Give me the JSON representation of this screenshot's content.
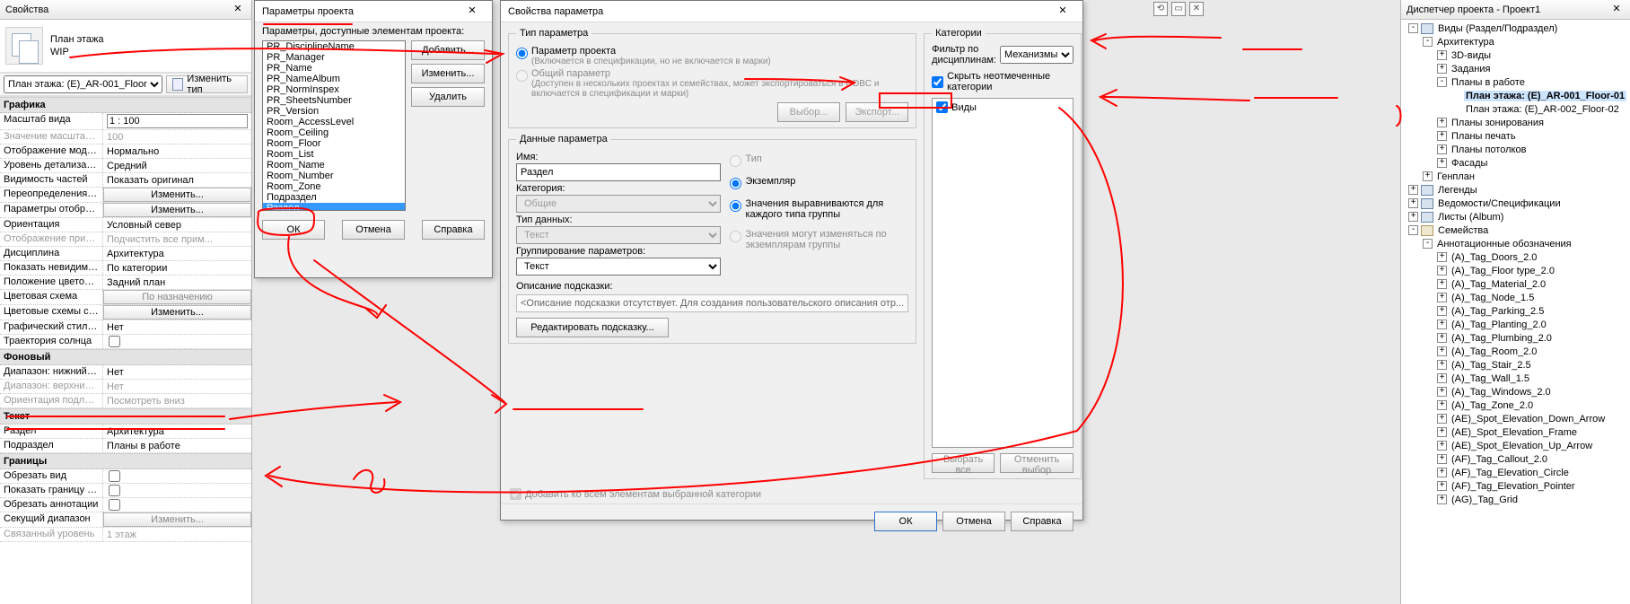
{
  "properties": {
    "title": "Свойства",
    "head_line1": "План этажа",
    "head_line2": "WIP",
    "selector": "План этажа: (E)_AR-001_Floor",
    "edit_type": "Изменить тип",
    "groups": [
      {
        "name": "Графика",
        "rows": [
          {
            "k": "Масштаб вида",
            "v": "1 : 100",
            "input": true
          },
          {
            "k": "Значение масштаба...",
            "v": "100",
            "dim": true
          },
          {
            "k": "Отображение модели",
            "v": "Нормально"
          },
          {
            "k": "Уровень детализации",
            "v": "Средний"
          },
          {
            "k": "Видимость частей",
            "v": "Показать оригинал"
          },
          {
            "k": "Переопределения в...",
            "v": "Изменить...",
            "btn": true
          },
          {
            "k": "Параметры отобра...",
            "v": "Изменить...",
            "btn": true
          },
          {
            "k": "Ориентация",
            "v": "Условный север"
          },
          {
            "k": "Отображение прим...",
            "v": "Подчистить все прим...",
            "dim": true
          },
          {
            "k": "Дисциплина",
            "v": "Архитектура"
          },
          {
            "k": "Показать невидимы...",
            "v": "По категории"
          },
          {
            "k": "Положение цветово...",
            "v": "Задний план"
          },
          {
            "k": "Цветовая схема",
            "v": "По назначению",
            "btn": true,
            "dimbtn": true
          },
          {
            "k": "Цветовые схемы сис...",
            "v": "Изменить...",
            "btn": true
          },
          {
            "k": "Графический стиль ...",
            "v": "Нет"
          },
          {
            "k": "Траектория солнца",
            "v": "",
            "chk": true
          }
        ]
      },
      {
        "name": "Фоновый",
        "rows": [
          {
            "k": "Диапазон: нижний у...",
            "v": "Нет"
          },
          {
            "k": "Диапазон: верхний у...",
            "v": "Нет",
            "dim": true
          },
          {
            "k": "Ориентация подлож...",
            "v": "Посмотреть вниз",
            "dim": true
          }
        ]
      },
      {
        "name": "Текст",
        "rows": [
          {
            "k": "Раздел",
            "v": "Архитектура"
          },
          {
            "k": "Подраздел",
            "v": "Планы в работе"
          }
        ]
      },
      {
        "name": "Границы",
        "rows": [
          {
            "k": "Обрезать вид",
            "v": "",
            "chk": true
          },
          {
            "k": "Показать границу о...",
            "v": "",
            "chk": true
          },
          {
            "k": "Обрезать аннотации",
            "v": "",
            "chk": true
          },
          {
            "k": "Секущий диапазон",
            "v": "Изменить...",
            "btn": true,
            "dimbtn": true
          },
          {
            "k": "Связанный уровень",
            "v": "1 этаж",
            "dim": true
          }
        ]
      }
    ]
  },
  "dlg1": {
    "title": "Параметры проекта",
    "label": "Параметры, доступные элементам проекта:",
    "items": [
      "PR_DisciplineName",
      "PR_Manager",
      "PR_Name",
      "PR_NameAlbum",
      "PR_NormInspex",
      "PR_SheetsNumber",
      "PR_Version",
      "Room_AccessLevel",
      "Room_Ceiling",
      "Room_Floor",
      "Room_List",
      "Room_Name",
      "Room_Number",
      "Room_Zone",
      "Подраздел",
      "Раздел"
    ],
    "selected": "Раздел",
    "btn_add": "Добавить...",
    "btn_edit": "Изменить...",
    "btn_del": "Удалить",
    "ok": "ОК",
    "cancel": "Отмена",
    "help": "Справка"
  },
  "dlg2": {
    "title": "Свойства параметра",
    "grp_type": "Тип параметра",
    "opt_proj": "Параметр проекта",
    "opt_proj_sub": "(Включается в спецификации, но не включается в марки)",
    "opt_shared": "Общий параметр",
    "opt_shared_sub": "(Доступен в нескольких проектах и семействах, может экспортироваться в ODBC и включается в спецификации и марки)",
    "btn_select": "Выбор...",
    "btn_export": "Экспорт...",
    "grp_data": "Данные параметра",
    "name_lbl": "Имя:",
    "name_val": "Раздел",
    "cat_lbl": "Категория:",
    "cat_val": "Общие",
    "dtype_lbl": "Тип данных:",
    "dtype_val": "Текст",
    "groupby_lbl": "Группирование параметров:",
    "groupby_val": "Текст",
    "hint_lbl": "Описание подсказки:",
    "hint_val": "<Описание подсказки отсутствует. Для создания пользовательского описания отр...",
    "btn_edit_hint": "Редактировать подсказку...",
    "r_type": "Тип",
    "r_inst": "Экземпляр",
    "r_align": "Значения выравниваются для каждого типа группы",
    "r_vary": "Значения могут изменяться по экземплярам группы",
    "add_all": "Добавить ко всем элементам выбранной категории",
    "grp_cat": "Категории",
    "filter_lbl": "Фильтр по дисциплинам:",
    "filter_val": "Механизмы",
    "hide_unchecked": "Скрыть неотмеченные категории",
    "cat_items": [
      {
        "label": "Виды",
        "checked": true
      }
    ],
    "btn_sel_all": "Выбрать все",
    "btn_clear": "Отменить выбор",
    "ok": "ОК",
    "cancel": "Отмена",
    "help": "Справка"
  },
  "title_icons": [
    "⟲",
    "▭",
    "✕"
  ],
  "browser": {
    "title": "Диспетчер проекта - Проект1",
    "tree": [
      {
        "d": 0,
        "tg": "-",
        "ic": "v",
        "lbl": "Виды (Раздел/Подраздел)"
      },
      {
        "d": 1,
        "tg": "-",
        "lbl": "Архитектура"
      },
      {
        "d": 2,
        "tg": "+",
        "lbl": "3D-виды"
      },
      {
        "d": 2,
        "tg": "+",
        "lbl": "Задания"
      },
      {
        "d": 2,
        "tg": "-",
        "lbl": "Планы в работе"
      },
      {
        "d": 3,
        "tg": "",
        "lbl": "План этажа: (E)_AR-001_Floor-01",
        "bold": true,
        "sel": true
      },
      {
        "d": 3,
        "tg": "",
        "lbl": "План этажа: (E)_AR-002_Floor-02"
      },
      {
        "d": 2,
        "tg": "+",
        "lbl": "Планы зонирования"
      },
      {
        "d": 2,
        "tg": "+",
        "lbl": "Планы печать"
      },
      {
        "d": 2,
        "tg": "+",
        "lbl": "Планы потолков"
      },
      {
        "d": 2,
        "tg": "+",
        "lbl": "Фасады"
      },
      {
        "d": 1,
        "tg": "+",
        "lbl": "Генплан"
      },
      {
        "d": 0,
        "tg": "+",
        "ic": "v",
        "lbl": "Легенды"
      },
      {
        "d": 0,
        "tg": "+",
        "ic": "v",
        "lbl": "Ведомости/Спецификации"
      },
      {
        "d": 0,
        "tg": "+",
        "ic": "v",
        "lbl": "Листы (Album)"
      },
      {
        "d": 0,
        "tg": "-",
        "ic": "f",
        "lbl": "Семейства"
      },
      {
        "d": 1,
        "tg": "-",
        "lbl": "Аннотационные обозначения"
      },
      {
        "d": 2,
        "tg": "+",
        "lbl": "(A)_Tag_Doors_2.0"
      },
      {
        "d": 2,
        "tg": "+",
        "lbl": "(A)_Tag_Floor type_2.0"
      },
      {
        "d": 2,
        "tg": "+",
        "lbl": "(A)_Tag_Material_2.0"
      },
      {
        "d": 2,
        "tg": "+",
        "lbl": "(A)_Tag_Node_1.5"
      },
      {
        "d": 2,
        "tg": "+",
        "lbl": "(A)_Tag_Parking_2.5"
      },
      {
        "d": 2,
        "tg": "+",
        "lbl": "(A)_Tag_Planting_2.0"
      },
      {
        "d": 2,
        "tg": "+",
        "lbl": "(A)_Tag_Plumbing_2.0"
      },
      {
        "d": 2,
        "tg": "+",
        "lbl": "(A)_Tag_Room_2.0"
      },
      {
        "d": 2,
        "tg": "+",
        "lbl": "(A)_Tag_Stair_2.5"
      },
      {
        "d": 2,
        "tg": "+",
        "lbl": "(A)_Tag_Wall_1.5"
      },
      {
        "d": 2,
        "tg": "+",
        "lbl": "(A)_Tag_Windows_2.0"
      },
      {
        "d": 2,
        "tg": "+",
        "lbl": "(A)_Tag_Zone_2.0"
      },
      {
        "d": 2,
        "tg": "+",
        "lbl": "(AE)_Spot_Elevation_Down_Arrow"
      },
      {
        "d": 2,
        "tg": "+",
        "lbl": "(AE)_Spot_Elevation_Frame"
      },
      {
        "d": 2,
        "tg": "+",
        "lbl": "(AE)_Spot_Elevation_Up_Arrow"
      },
      {
        "d": 2,
        "tg": "+",
        "lbl": "(AF)_Tag_Callout_2.0"
      },
      {
        "d": 2,
        "tg": "+",
        "lbl": "(AF)_Tag_Elevation_Circle"
      },
      {
        "d": 2,
        "tg": "+",
        "lbl": "(AF)_Tag_Elevation_Pointer"
      },
      {
        "d": 2,
        "tg": "+",
        "lbl": "(AG)_Tag_Grid"
      }
    ]
  }
}
